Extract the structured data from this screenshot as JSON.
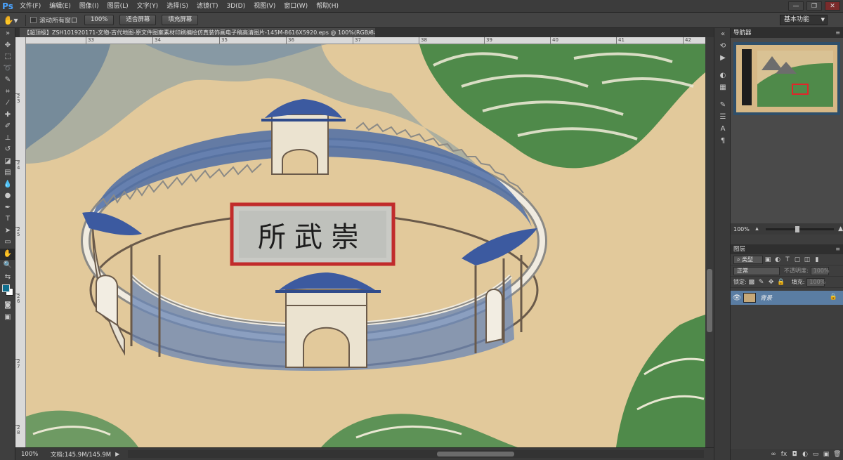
{
  "app": {
    "logo": "Ps",
    "window_controls": [
      "—",
      "❐",
      "✕"
    ]
  },
  "menu": [
    "文件(F)",
    "编辑(E)",
    "图像(I)",
    "图层(L)",
    "文字(Y)",
    "选择(S)",
    "滤镜(T)",
    "3D(D)",
    "视图(V)",
    "窗口(W)",
    "帮助(H)"
  ],
  "options": {
    "scroll_all_label": "滚动所有窗口",
    "btn_100": "100%",
    "btn_fit": "适合屏幕",
    "btn_fill": "填充屏幕",
    "workspace": "基本功能"
  },
  "document": {
    "tab_title": "【超顶级】ZSH101920171-文物-古代地图-原文件图案素材印刷编绘仿真装饰画电子稿高清图片-145M-8616X5920.eps @ 100%(RGB/8#)",
    "tab_close": "×",
    "ruler_top": [
      "33",
      "34",
      "35",
      "36",
      "37",
      "38",
      "39",
      "40",
      "41",
      "42"
    ],
    "ruler_left": [
      "2 3",
      "2 4",
      "2 5",
      "2 6",
      "2 7",
      "2 8"
    ],
    "plaque_text": "所武崇"
  },
  "status": {
    "zoom": "100%",
    "doc_info": "文档:145.9M/145.9M",
    "arrow": "▶"
  },
  "navigator": {
    "title": "导航器",
    "zoom": "100%"
  },
  "layers": {
    "title": "图层",
    "filter_kind": "类型",
    "blend_mode": "正常",
    "opacity_label": "不透明度:",
    "opacity_value": "100%",
    "lock_label": "锁定:",
    "fill_label": "填充:",
    "fill_value": "100%",
    "layer_name": "背景"
  },
  "colors": {
    "foreground": "#0f6f8f",
    "background": "#ffffff",
    "layer_selected": "#5a7da3",
    "parchment": "#e2c99b"
  }
}
